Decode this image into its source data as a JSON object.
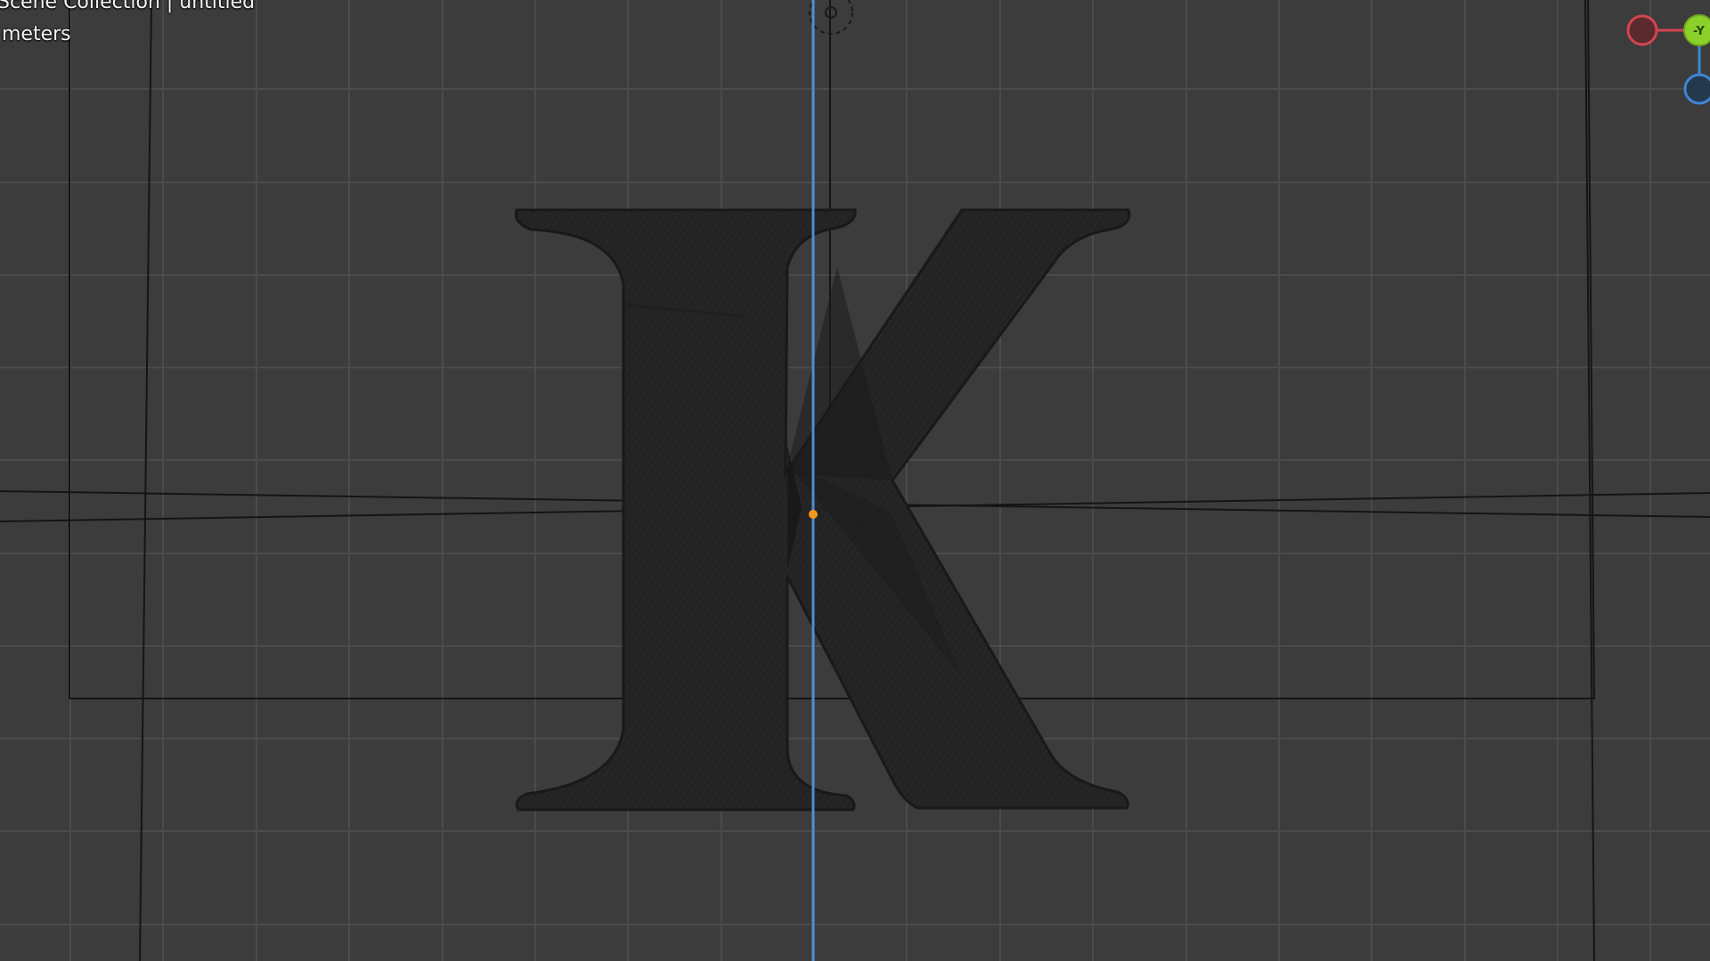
{
  "viewport": {
    "collection_text": "Scene Collection | untitled",
    "units_text": "meters",
    "background_color": "#3c3c3c",
    "grid_color": "#4c4c4c",
    "object_name": "K",
    "object_wire_color": "#1e1e1e",
    "origin_color": "#f39a1c",
    "axis_line_color": "#4a8fd4"
  },
  "gizmo": {
    "x_color": "#d2464f",
    "y_color": "#8bd12a",
    "z_color": "#3f86d6",
    "y_label": "-Y"
  },
  "icons": {
    "camera_icon": "camera-icon",
    "light_icon": "light-icon"
  }
}
